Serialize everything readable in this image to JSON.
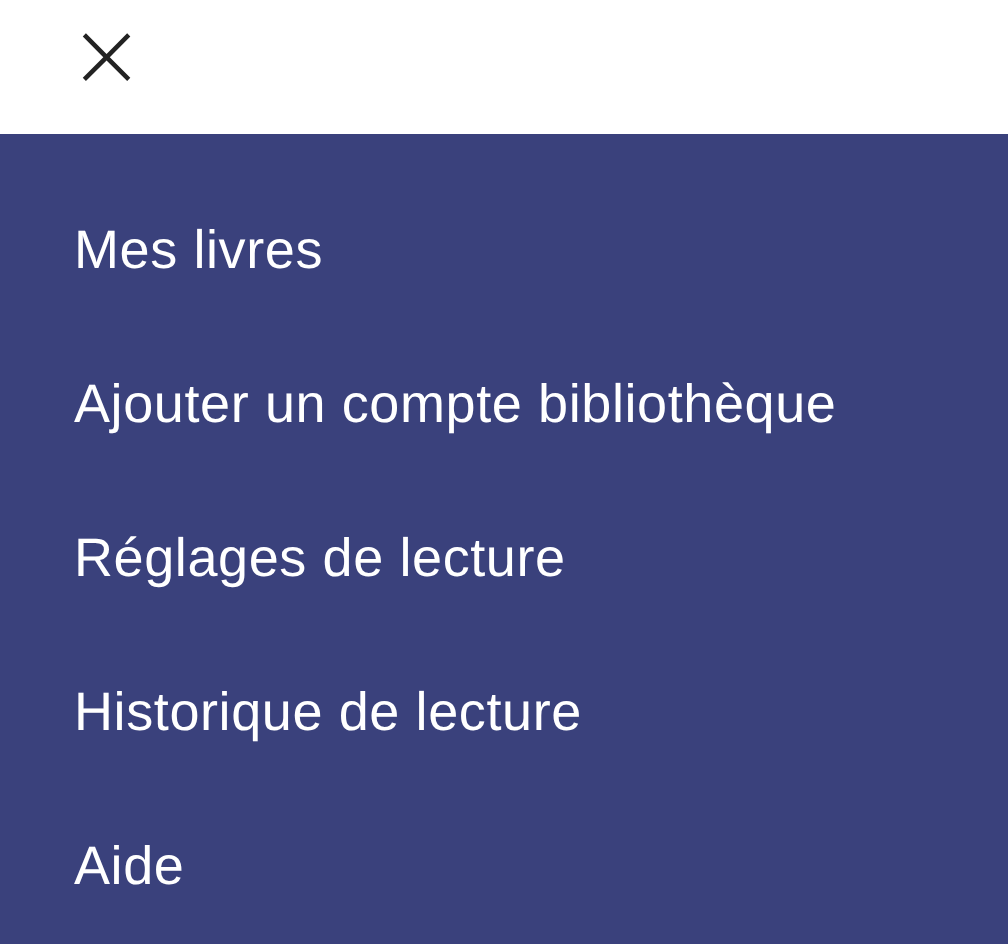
{
  "header": {
    "close": "×"
  },
  "menu": {
    "items": [
      {
        "label": "Mes livres"
      },
      {
        "label": "Ajouter un compte bibliothèque"
      },
      {
        "label": "Réglages de lecture"
      },
      {
        "label": "Historique de lecture"
      },
      {
        "label": "Aide"
      }
    ]
  }
}
